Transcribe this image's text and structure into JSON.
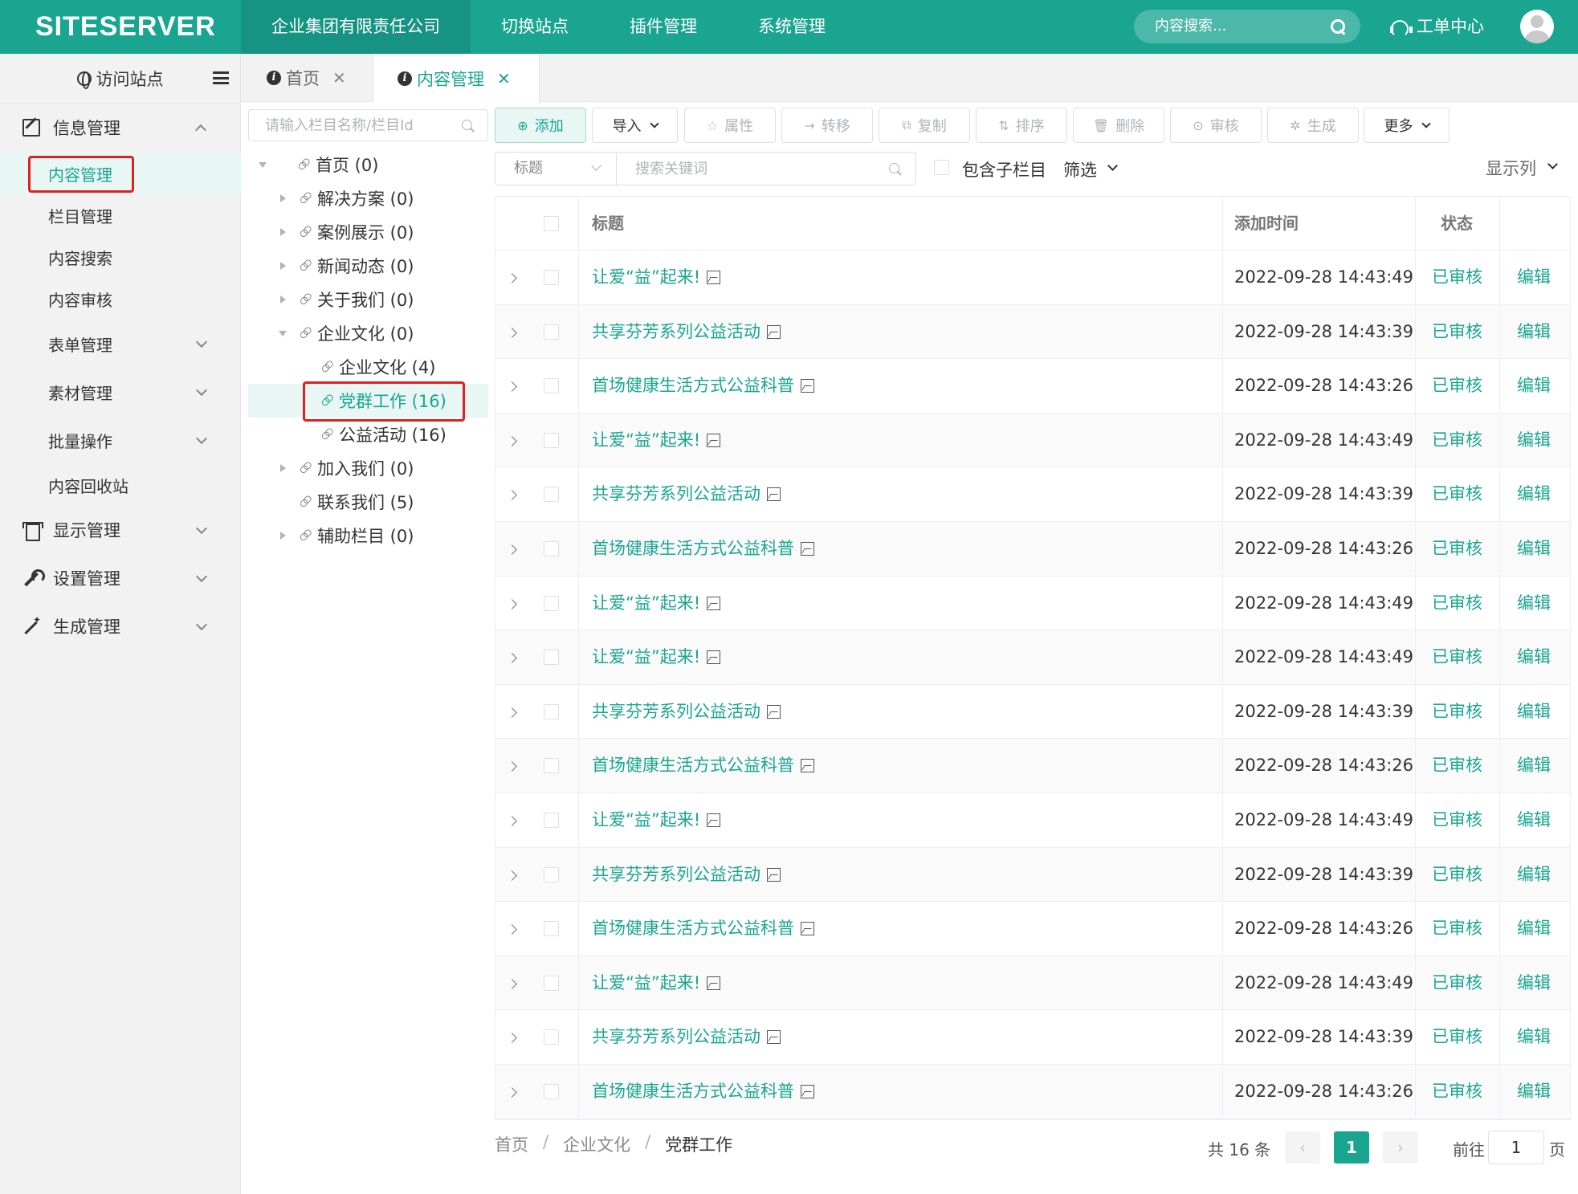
{
  "app": {
    "logo": "SITESERVER",
    "nav": [
      "企业集团有限责任公司",
      "切换站点",
      "插件管理",
      "系统管理"
    ],
    "search_placeholder": "内容搜索...",
    "work_order": "工单中心"
  },
  "sidebar": {
    "visit": "访问站点",
    "groups": {
      "info": "信息管理",
      "info_items": [
        "内容管理",
        "栏目管理",
        "内容搜索",
        "内容审核",
        "表单管理",
        "素材管理",
        "批量操作",
        "内容回收站"
      ],
      "display": "显示管理",
      "settings": "设置管理",
      "generate": "生成管理"
    }
  },
  "tabs": {
    "home": "首页",
    "content": "内容管理",
    "close": "✕"
  },
  "tree": {
    "search_placeholder": "请输入栏目名称/栏目Id",
    "nodes": [
      {
        "label": "首页 (0)"
      },
      {
        "label": "解决方案 (0)"
      },
      {
        "label": "案例展示 (0)"
      },
      {
        "label": "新闻动态 (0)"
      },
      {
        "label": "关于我们 (0)"
      },
      {
        "label": "企业文化 (0)"
      },
      {
        "label": "企业文化 (4)"
      },
      {
        "label": "党群工作 (16)"
      },
      {
        "label": "公益活动 (16)"
      },
      {
        "label": "加入我们 (0)"
      },
      {
        "label": "联系我们 (5)"
      },
      {
        "label": "辅助栏目 (0)"
      }
    ]
  },
  "toolbar": {
    "add": "添加",
    "import": "导入",
    "attr": "属性",
    "move": "转移",
    "copy": "复制",
    "sort": "排序",
    "delete": "删除",
    "audit": "审核",
    "generate": "生成",
    "more": "更多",
    "icons": {
      "add": "⊕",
      "attr": "☆",
      "move": "→",
      "copy": "⧉",
      "sort": "⇅",
      "delete": "🗑",
      "audit": "⊙",
      "generate": "✲"
    }
  },
  "filter": {
    "field": "标题",
    "keyword_placeholder": "搜索关键词",
    "include_children": "包含子栏目",
    "screen": "筛选",
    "columns": "显示列"
  },
  "table": {
    "headers": {
      "title": "标题",
      "time": "添加时间",
      "status": "状态"
    },
    "rows": [
      {
        "title": "让爱“益”起来!",
        "time": "2022-09-28 14:43:49",
        "status": "已审核",
        "edit": "编辑"
      },
      {
        "title": "共享芬芳系列公益活动",
        "time": "2022-09-28 14:43:39",
        "status": "已审核",
        "edit": "编辑"
      },
      {
        "title": "首场健康生活方式公益科普",
        "time": "2022-09-28 14:43:26",
        "status": "已审核",
        "edit": "编辑"
      },
      {
        "title": "让爱“益”起来!",
        "time": "2022-09-28 14:43:49",
        "status": "已审核",
        "edit": "编辑"
      },
      {
        "title": "共享芬芳系列公益活动",
        "time": "2022-09-28 14:43:39",
        "status": "已审核",
        "edit": "编辑"
      },
      {
        "title": "首场健康生活方式公益科普",
        "time": "2022-09-28 14:43:26",
        "status": "已审核",
        "edit": "编辑"
      },
      {
        "title": "让爱“益”起来!",
        "time": "2022-09-28 14:43:49",
        "status": "已审核",
        "edit": "编辑"
      },
      {
        "title": "让爱“益”起来!",
        "time": "2022-09-28 14:43:49",
        "status": "已审核",
        "edit": "编辑"
      },
      {
        "title": "共享芬芳系列公益活动",
        "time": "2022-09-28 14:43:39",
        "status": "已审核",
        "edit": "编辑"
      },
      {
        "title": "首场健康生活方式公益科普",
        "time": "2022-09-28 14:43:26",
        "status": "已审核",
        "edit": "编辑"
      },
      {
        "title": "让爱“益”起来!",
        "time": "2022-09-28 14:43:49",
        "status": "已审核",
        "edit": "编辑"
      },
      {
        "title": "共享芬芳系列公益活动",
        "time": "2022-09-28 14:43:39",
        "status": "已审核",
        "edit": "编辑"
      },
      {
        "title": "首场健康生活方式公益科普",
        "time": "2022-09-28 14:43:26",
        "status": "已审核",
        "edit": "编辑"
      },
      {
        "title": "让爱“益”起来!",
        "time": "2022-09-28 14:43:49",
        "status": "已审核",
        "edit": "编辑"
      },
      {
        "title": "共享芬芳系列公益活动",
        "time": "2022-09-28 14:43:39",
        "status": "已审核",
        "edit": "编辑"
      },
      {
        "title": "首场健康生活方式公益科普",
        "time": "2022-09-28 14:43:26",
        "status": "已审核",
        "edit": "编辑"
      }
    ]
  },
  "footer": {
    "breadcrumb": [
      "首页",
      "企业文化",
      "党群工作"
    ],
    "separator": "/",
    "total": "共 16 条",
    "prev": "‹",
    "current_page": "1",
    "next": "›",
    "goto_prefix": "前往",
    "goto_value": "1",
    "goto_suffix": "页"
  },
  "colors": {
    "accent": "#1aa591",
    "highlight": "#e02020"
  }
}
